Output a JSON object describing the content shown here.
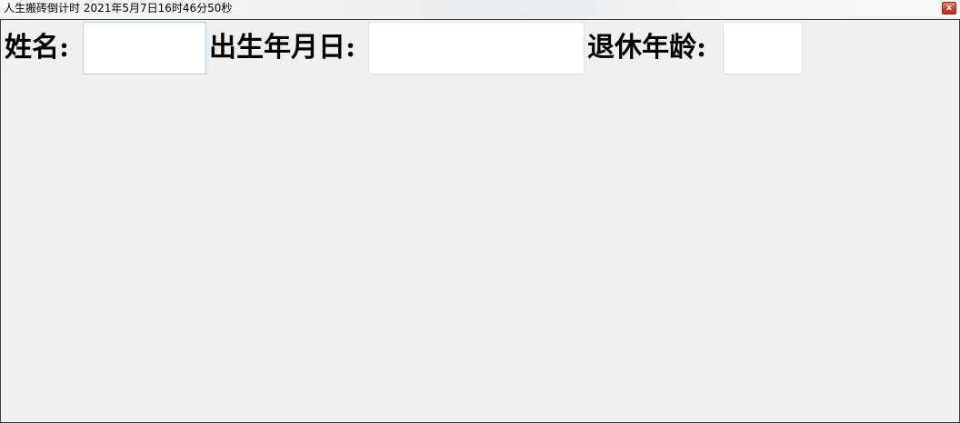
{
  "window": {
    "title": "人生搬砖倒计时 2021年5月7日16时46分50秒",
    "close_glyph": "x"
  },
  "form": {
    "name_label": "姓名:",
    "name_value": "",
    "birthdate_label": "出生年月日:",
    "birthdate_value": "",
    "retire_age_label": "退休年龄:",
    "retire_age_value": ""
  },
  "icons": [
    "close-icon"
  ]
}
